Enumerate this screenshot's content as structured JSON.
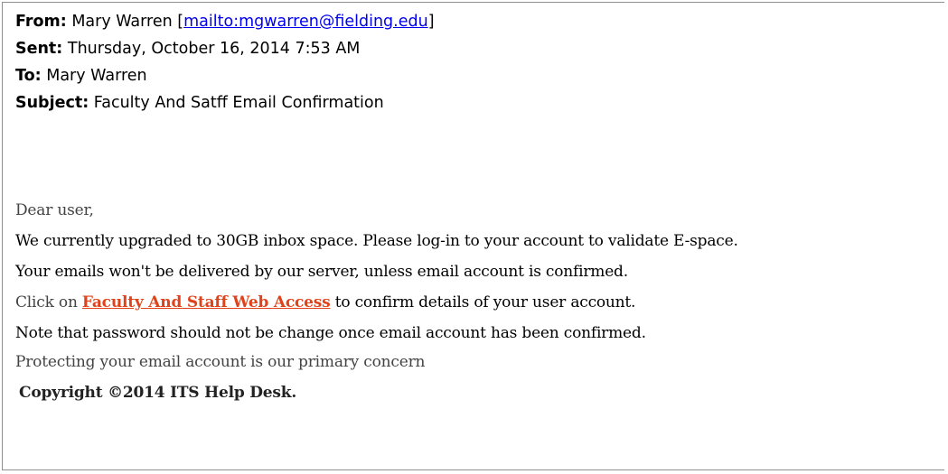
{
  "header": {
    "from_label": "From:",
    "from_name": "Mary Warren",
    "from_open_bracket": "[",
    "from_link": "mailto:mgwarren@fielding.edu",
    "from_close_bracket": "]",
    "sent_label": "Sent:",
    "sent_value": "Thursday, October 16, 2014 7:53 AM",
    "to_label": "To:",
    "to_value": "Mary Warren",
    "subject_label": "Subject:",
    "subject_value": "Faculty And Satff Email Confirmation"
  },
  "body": {
    "greeting": "Dear user,",
    "line1": "We currently upgraded to 30GB inbox space. Please log-in to your account to validate E-space.",
    "line2": "Your emails won't be delivered by our server, unless email account is confirmed.",
    "line3_prefix": "Click on",
    "line3_link": "Faculty And Staff Web Access",
    "line3_suffix": "to confirm details of your user account.",
    "line4": "Note that password should not be change once email account has been confirmed.",
    "line5": "Protecting your email account is our primary concern",
    "copyright": "Copyright ©2014 ITS Help Desk."
  },
  "colors": {
    "link": "#0000ee",
    "phish_link": "#e0431b",
    "border": "#8f8f8f"
  }
}
